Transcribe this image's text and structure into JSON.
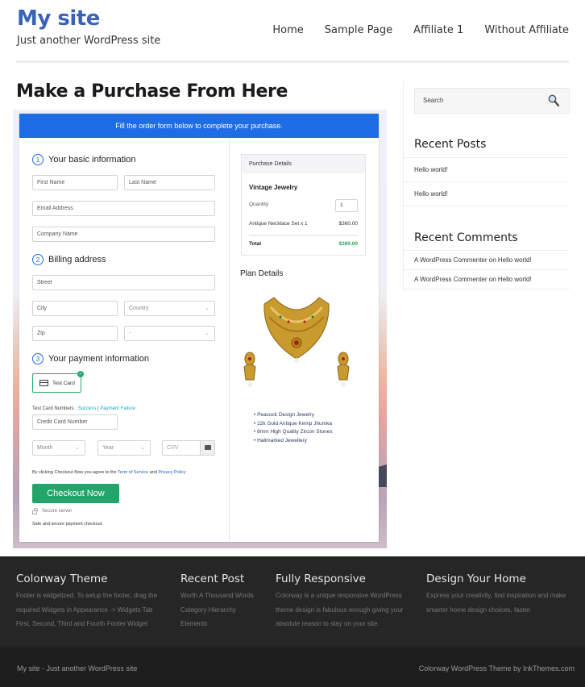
{
  "header": {
    "site_title": "My site",
    "tagline": "Just another WordPress site",
    "nav": [
      "Home",
      "Sample Page",
      "Affiliate 1",
      "Without Affiliate"
    ]
  },
  "page": {
    "title": "Make a Purchase From Here"
  },
  "checkout": {
    "banner": "Fill the order form below to complete your purchase.",
    "sections": [
      {
        "number": "1",
        "title": "Your basic information"
      },
      {
        "number": "2",
        "title": "Billing address"
      },
      {
        "number": "3",
        "title": "Your payment information"
      }
    ],
    "fields": {
      "first_name": "First Name",
      "last_name": "Last Name",
      "email": "Email Address",
      "company": "Company Name",
      "street": "Street",
      "city": "City",
      "country": "Country",
      "zip": "Zip",
      "state": "-",
      "card_number": "Credit Card Number",
      "month": "Month",
      "year": "Year",
      "cvv": "CVV"
    },
    "payment_method": "Test Card",
    "test_cards": {
      "label": "Test Card Numbers : ",
      "success": "Success",
      "separator": " | ",
      "failure": "Payment Failure"
    },
    "agree": {
      "prefix": "By clicking Checkout Now you agree to the ",
      "terms": "Term of Service",
      "and": " and ",
      "privacy": "Privacy Policy"
    },
    "checkout_button": "Checkout Now",
    "secure_server": "Secure server",
    "safe_text": "Safe and secure payment checkout.",
    "purchase_details": {
      "heading": "Purchase Details",
      "product": "Vintage Jewelry",
      "quantity_label": "Quantity",
      "quantity": "1",
      "line_item": "Antique Necklace Set x 1",
      "line_price": "$360.00",
      "total_label": "Total",
      "total": "$360.00"
    },
    "plan": {
      "title": "Plan Details",
      "features": [
        "Peacock Design Jewelry",
        "22k Gold Antique Kemp Jhumka",
        "8mm High Quality Zircon Stones",
        "Hallmarked Jewellery"
      ]
    }
  },
  "sidebar": {
    "search_placeholder": "Search",
    "recent_posts_title": "Recent Posts",
    "recent_posts": [
      "Hello world!",
      "Hello world!"
    ],
    "recent_comments_title": "Recent Comments",
    "recent_comments": [
      "A WordPress Commenter on Hello world!",
      "A WordPress Commenter on Hello world!"
    ]
  },
  "footer": {
    "columns": [
      {
        "title": "Colorway Theme",
        "lines": [
          "Footer is widgetized. To setup the footer, drag the",
          "required Widgets in Appearance -> Widgets Tab",
          "First, Second, Third and Fourth Footer Widget"
        ]
      },
      {
        "title": "Recent Post",
        "lines": [
          "Worth A Thousand Words",
          "Category Hierarchy",
          "Elements"
        ]
      },
      {
        "title": "Fully Responsive",
        "lines": [
          "Colorway is a unique responsive WordPress",
          "theme design is fabulous enough giving your",
          "absolute reason to stay on your site."
        ]
      },
      {
        "title": "Design Your Home",
        "lines": [
          "Express your creativity, find inspiration and make",
          "smarter home design choices, faster."
        ]
      }
    ],
    "bottom_left": "My site - Just another WordPress site",
    "bottom_right": "Colorway WordPress Theme by InkThemes.com"
  }
}
